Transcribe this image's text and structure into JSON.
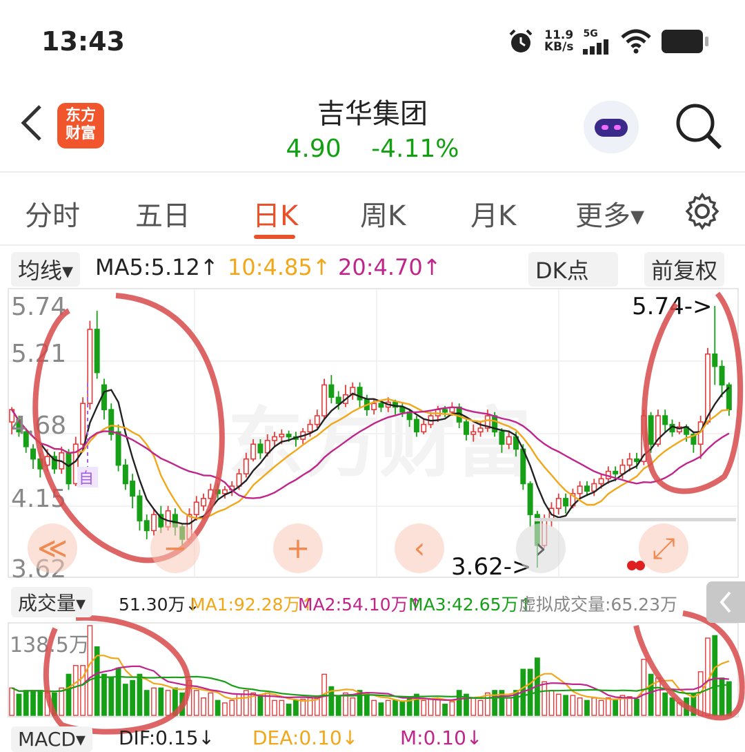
{
  "status": {
    "time": "13:43",
    "net_speed": "11.9",
    "net_unit": "KB/s",
    "signal": "5G"
  },
  "header": {
    "logo_line1": "东方",
    "logo_line2": "财富",
    "title": "吉华集团",
    "price": "4.90",
    "change": "-4.11%"
  },
  "tabs": [
    "分时",
    "五日",
    "日K",
    "周K",
    "月K",
    "更多▾"
  ],
  "active_tab": "日K",
  "indicator_bar": {
    "ma_selector": "均线▾",
    "ma5": "MA5:5.12↑",
    "ma10": "10:4.85↑",
    "ma20": "20:4.70↑",
    "dk_button": "DK点",
    "adjust_button": "前复权"
  },
  "price_axis": {
    "top": "5.74",
    "mid1": "5.21",
    "mid2": "4.68",
    "mid3": "4.15",
    "bottom": "3.62"
  },
  "annotations": {
    "high": "5.74->",
    "low": "3.62->",
    "marker": "自"
  },
  "volume_bar": {
    "selector": "成交量▾",
    "vol": "51.30万↓",
    "ma1": "MA1:92.28万↑",
    "ma2": "MA2:54.10万↑",
    "ma3": "MA3:42.65万↑",
    "virtual": "虚拟成交量:65.23万"
  },
  "volume_axis": {
    "top": "138.5万"
  },
  "macd_bar": {
    "selector": "MACD▾",
    "dif": "DIF:0.15↓",
    "dea": "DEA:0.10↓",
    "m": "M:0.10↓"
  },
  "overlay_buttons": {
    "rewind": "≪",
    "zoom_out": "−",
    "zoom_in": "+",
    "prev": "‹",
    "next": "›",
    "fullscreen": "⤢"
  },
  "watermark": "东方财富",
  "colors": {
    "up": "#e23b3b",
    "down": "#17a017",
    "ma5": "#222222",
    "ma10": "#f0a71a",
    "ma20": "#c0258c",
    "accent": "#e8522a",
    "annotation": "#d84a4a"
  },
  "chart_data": {
    "type": "candlestick",
    "ylim": [
      3.62,
      5.74
    ],
    "candles": [
      [
        4.8,
        4.9,
        4.7,
        4.92
      ],
      [
        4.82,
        4.72,
        4.68,
        4.85
      ],
      [
        4.72,
        4.6,
        4.55,
        4.75
      ],
      [
        4.58,
        4.5,
        4.42,
        4.62
      ],
      [
        4.5,
        4.42,
        4.35,
        4.55
      ],
      [
        4.45,
        4.52,
        4.4,
        4.58
      ],
      [
        4.52,
        4.42,
        4.38,
        4.56
      ],
      [
        4.42,
        4.55,
        4.38,
        4.6
      ],
      [
        4.55,
        4.3,
        4.25,
        4.58
      ],
      [
        4.3,
        4.62,
        4.28,
        4.68
      ],
      [
        4.62,
        4.95,
        4.6,
        5.0
      ],
      [
        4.95,
        5.55,
        4.9,
        5.62
      ],
      [
        5.55,
        5.2,
        5.15,
        5.7
      ],
      [
        5.1,
        4.9,
        4.82,
        5.15
      ],
      [
        4.9,
        4.7,
        4.65,
        4.95
      ],
      [
        4.72,
        4.45,
        4.4,
        4.78
      ],
      [
        4.45,
        4.3,
        4.25,
        4.5
      ],
      [
        4.32,
        4.2,
        4.1,
        4.38
      ],
      [
        4.2,
        4.0,
        3.92,
        4.25
      ],
      [
        4.0,
        3.92,
        3.85,
        4.05
      ],
      [
        3.92,
        4.05,
        3.88,
        4.1
      ],
      [
        4.05,
        3.95,
        3.9,
        4.12
      ],
      [
        3.95,
        4.08,
        3.92,
        4.12
      ],
      [
        4.05,
        3.95,
        3.88,
        4.1
      ],
      [
        3.95,
        3.85,
        3.8,
        3.98
      ],
      [
        3.85,
        4.05,
        3.82,
        4.1
      ],
      [
        4.05,
        4.15,
        4.0,
        4.2
      ],
      [
        4.12,
        4.18,
        4.08,
        4.22
      ],
      [
        4.18,
        4.25,
        4.12,
        4.3
      ],
      [
        4.25,
        4.22,
        4.18,
        4.3
      ],
      [
        4.22,
        4.25,
        4.18,
        4.28
      ],
      [
        4.25,
        4.28,
        4.2,
        4.32
      ],
      [
        4.28,
        4.38,
        4.25,
        4.42
      ],
      [
        4.38,
        4.5,
        4.35,
        4.55
      ],
      [
        4.5,
        4.62,
        4.48,
        4.66
      ],
      [
        4.62,
        4.55,
        4.5,
        4.66
      ],
      [
        4.55,
        4.65,
        4.52,
        4.7
      ],
      [
        4.65,
        4.68,
        4.6,
        4.72
      ],
      [
        4.68,
        4.7,
        4.62,
        4.74
      ],
      [
        4.7,
        4.68,
        4.64,
        4.73
      ],
      [
        4.68,
        4.66,
        4.6,
        4.72
      ],
      [
        4.66,
        4.72,
        4.62,
        4.75
      ],
      [
        4.72,
        4.78,
        4.68,
        4.82
      ],
      [
        4.78,
        4.85,
        4.75,
        4.9
      ],
      [
        4.85,
        5.1,
        4.82,
        5.15
      ],
      [
        5.1,
        5.0,
        4.95,
        5.18
      ],
      [
        5.0,
        4.95,
        4.9,
        5.05
      ],
      [
        4.95,
        5.02,
        4.92,
        5.1
      ],
      [
        5.02,
        5.08,
        4.98,
        5.12
      ],
      [
        5.08,
        4.98,
        4.92,
        5.12
      ],
      [
        4.98,
        4.9,
        4.85,
        5.02
      ],
      [
        4.9,
        4.95,
        4.86,
        4.98
      ],
      [
        4.95,
        4.92,
        4.88,
        4.98
      ],
      [
        4.92,
        4.96,
        4.88,
        5.0
      ],
      [
        4.96,
        4.92,
        4.86,
        4.98
      ],
      [
        4.92,
        4.88,
        4.84,
        4.95
      ],
      [
        4.88,
        4.82,
        4.76,
        4.9
      ],
      [
        4.82,
        4.72,
        4.68,
        4.85
      ],
      [
        4.72,
        4.78,
        4.7,
        4.82
      ],
      [
        4.78,
        4.85,
        4.75,
        4.88
      ],
      [
        4.85,
        4.9,
        4.8,
        4.93
      ],
      [
        4.9,
        4.88,
        4.84,
        4.93
      ],
      [
        4.88,
        4.92,
        4.85,
        4.96
      ],
      [
        4.92,
        4.8,
        4.75,
        4.95
      ],
      [
        4.8,
        4.7,
        4.65,
        4.82
      ],
      [
        4.7,
        4.72,
        4.64,
        4.78
      ],
      [
        4.72,
        4.75,
        4.68,
        4.8
      ],
      [
        4.75,
        4.85,
        4.72,
        4.9
      ],
      [
        4.85,
        4.72,
        4.68,
        4.88
      ],
      [
        4.72,
        4.62,
        4.55,
        4.75
      ],
      [
        4.62,
        4.68,
        4.58,
        4.72
      ],
      [
        4.68,
        4.58,
        4.52,
        4.72
      ],
      [
        4.58,
        4.3,
        4.25,
        4.62
      ],
      [
        4.3,
        4.05,
        3.95,
        4.32
      ],
      [
        4.05,
        3.8,
        3.62,
        4.08
      ],
      [
        3.8,
        4.0,
        3.78,
        4.05
      ],
      [
        4.0,
        4.1,
        3.95,
        4.15
      ],
      [
        4.1,
        4.18,
        4.05,
        4.22
      ],
      [
        4.18,
        4.12,
        4.06,
        4.22
      ],
      [
        4.12,
        4.22,
        4.1,
        4.26
      ],
      [
        4.22,
        4.28,
        4.18,
        4.32
      ],
      [
        4.28,
        4.24,
        4.2,
        4.32
      ],
      [
        4.24,
        4.3,
        4.2,
        4.34
      ],
      [
        4.3,
        4.34,
        4.26,
        4.38
      ],
      [
        4.34,
        4.4,
        4.3,
        4.44
      ],
      [
        4.4,
        4.38,
        4.32,
        4.44
      ],
      [
        4.38,
        4.45,
        4.34,
        4.5
      ],
      [
        4.45,
        4.5,
        4.4,
        4.55
      ],
      [
        4.5,
        4.48,
        4.42,
        4.55
      ],
      [
        4.48,
        4.85,
        4.45,
        4.9
      ],
      [
        4.85,
        4.62,
        4.55,
        4.88
      ],
      [
        4.62,
        4.85,
        4.6,
        4.9
      ],
      [
        4.85,
        4.78,
        4.72,
        4.9
      ],
      [
        4.78,
        4.72,
        4.68,
        4.82
      ],
      [
        4.72,
        4.76,
        4.7,
        4.8
      ],
      [
        4.76,
        4.7,
        4.64,
        4.78
      ],
      [
        4.7,
        4.62,
        4.55,
        4.72
      ],
      [
        4.62,
        4.8,
        4.5,
        4.85
      ],
      [
        4.8,
        5.35,
        4.78,
        5.4
      ],
      [
        5.35,
        5.25,
        5.1,
        5.74
      ],
      [
        5.25,
        5.1,
        5.0,
        5.3
      ],
      [
        5.1,
        4.9,
        4.85,
        5.12
      ]
    ],
    "volume_max": 138.5
  }
}
